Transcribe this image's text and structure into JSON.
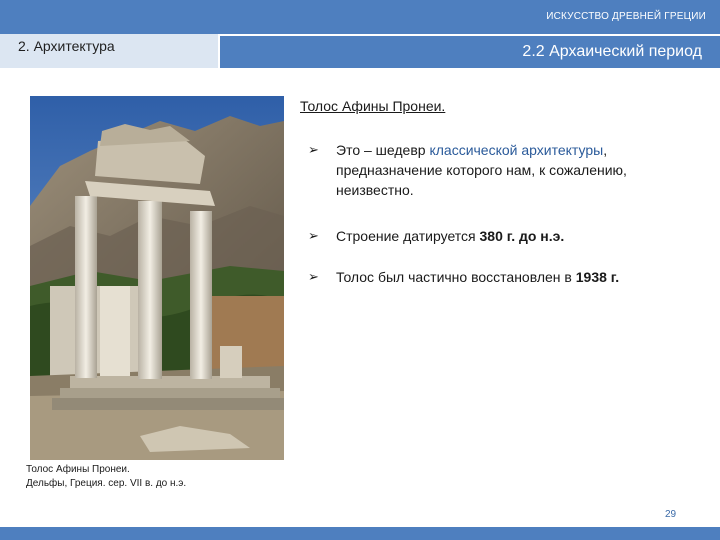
{
  "header": {
    "top_title": "ИСКУССТВО ДРЕВНЕЙ ГРЕЦИИ"
  },
  "section": {
    "left_title": "2. Архитектура",
    "right_title": "2.2 Архаический период"
  },
  "photo": {
    "subject": "tholos-ruins"
  },
  "caption": {
    "line1": "Толос Афины Пронеи.",
    "line2": "Дельфы, Греция. сер. VII в. до н.э."
  },
  "content": {
    "heading": "Толос Афины Пронеи.",
    "bullets": [
      {
        "pre": "Это – шедевр ",
        "blue": "классической архитектуры",
        "post": ", предназначение которого нам, к сожалению, неизвестно."
      },
      {
        "pre": "Строение датируется ",
        "bold": "380 г. до н.э."
      },
      {
        "pre": "Толос был частично восстановлен в ",
        "bold": "1938 г."
      }
    ]
  },
  "footer": {
    "page_number": "29"
  },
  "colors": {
    "accent": "#4e7fbf",
    "light": "#dce6f2",
    "link": "#2a5a9a"
  }
}
